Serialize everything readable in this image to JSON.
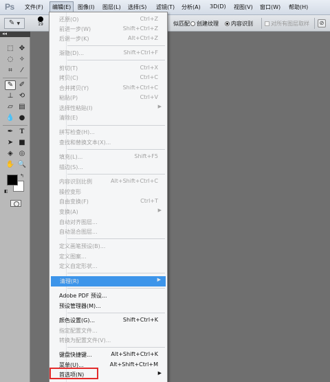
{
  "app": {
    "logo": "Ps"
  },
  "menubar": {
    "items": [
      "文件(F)",
      "编辑(E)",
      "图像(I)",
      "图层(L)",
      "选择(S)",
      "滤镜(T)",
      "分析(A)",
      "3D(D)",
      "视图(V)",
      "窗口(W)",
      "帮助(H)"
    ]
  },
  "options": {
    "brush_size": "19",
    "proximity_match_partial": "似匹配",
    "create_texture": "创建纹理",
    "content_aware": "内容识别",
    "content_aware_selected": true,
    "sample_all_layers": "对所有图层取样"
  },
  "edit_menu": {
    "items": [
      {
        "label": "还原(O)",
        "shortcut": "Ctrl+Z",
        "state": "disabled"
      },
      {
        "label": "前进一步(W)",
        "shortcut": "Shift+Ctrl+Z",
        "state": "disabled"
      },
      {
        "label": "后退一步(K)",
        "shortcut": "Alt+Ctrl+Z",
        "state": "disabled"
      },
      {
        "label": "渐隐(D)...",
        "shortcut": "Shift+Ctrl+F",
        "state": "disabled"
      },
      {
        "label": "剪切(T)",
        "shortcut": "Ctrl+X",
        "state": "disabled"
      },
      {
        "label": "拷贝(C)",
        "shortcut": "Ctrl+C",
        "state": "disabled"
      },
      {
        "label": "合并拷贝(Y)",
        "shortcut": "Shift+Ctrl+C",
        "state": "disabled"
      },
      {
        "label": "粘贴(P)",
        "shortcut": "Ctrl+V",
        "state": "disabled"
      },
      {
        "label": "选择性粘贴(I)",
        "shortcut": "",
        "state": "disabled",
        "submenu": true
      },
      {
        "label": "清除(E)",
        "shortcut": "",
        "state": "disabled"
      },
      {
        "label": "拼写检查(H)...",
        "shortcut": "",
        "state": "disabled"
      },
      {
        "label": "查找和替换文本(X)...",
        "shortcut": "",
        "state": "disabled"
      },
      {
        "label": "填充(L)...",
        "shortcut": "Shift+F5",
        "state": "disabled"
      },
      {
        "label": "描边(S)...",
        "shortcut": "",
        "state": "disabled"
      },
      {
        "label": "内容识别比例",
        "shortcut": "Alt+Shift+Ctrl+C",
        "state": "disabled"
      },
      {
        "label": "操控变形",
        "shortcut": "",
        "state": "disabled"
      },
      {
        "label": "自由变换(F)",
        "shortcut": "Ctrl+T",
        "state": "disabled"
      },
      {
        "label": "变换(A)",
        "shortcut": "",
        "state": "disabled",
        "submenu": true
      },
      {
        "label": "自动对齐图层...",
        "shortcut": "",
        "state": "disabled"
      },
      {
        "label": "自动混合图层...",
        "shortcut": "",
        "state": "disabled"
      },
      {
        "label": "定义画笔预设(B)...",
        "shortcut": "",
        "state": "disabled"
      },
      {
        "label": "定义图案...",
        "shortcut": "",
        "state": "disabled"
      },
      {
        "label": "定义自定形状...",
        "shortcut": "",
        "state": "disabled"
      },
      {
        "label": "清理(R)",
        "shortcut": "",
        "state": "highlighted",
        "submenu": true
      },
      {
        "label": "Adobe PDF 预设...",
        "shortcut": "",
        "state": "enabled"
      },
      {
        "label": "预设管理器(M)...",
        "shortcut": "",
        "state": "enabled"
      },
      {
        "label": "颜色设置(G)...",
        "shortcut": "Shift+Ctrl+K",
        "state": "enabled"
      },
      {
        "label": "指定配置文件...",
        "shortcut": "",
        "state": "disabled"
      },
      {
        "label": "转换为配置文件(V)...",
        "shortcut": "",
        "state": "disabled"
      },
      {
        "label": "键盘快捷键...",
        "shortcut": "Alt+Shift+Ctrl+K",
        "state": "enabled"
      },
      {
        "label": "菜单(U)...",
        "shortcut": "Alt+Shift+Ctrl+M",
        "state": "enabled"
      },
      {
        "label": "首选项(N)",
        "shortcut": "",
        "state": "enabled",
        "submenu": true
      }
    ]
  },
  "colors": {
    "highlight": "#3d95ea",
    "annotation": "#e22a2a",
    "canvas": "#6f6f6f"
  }
}
